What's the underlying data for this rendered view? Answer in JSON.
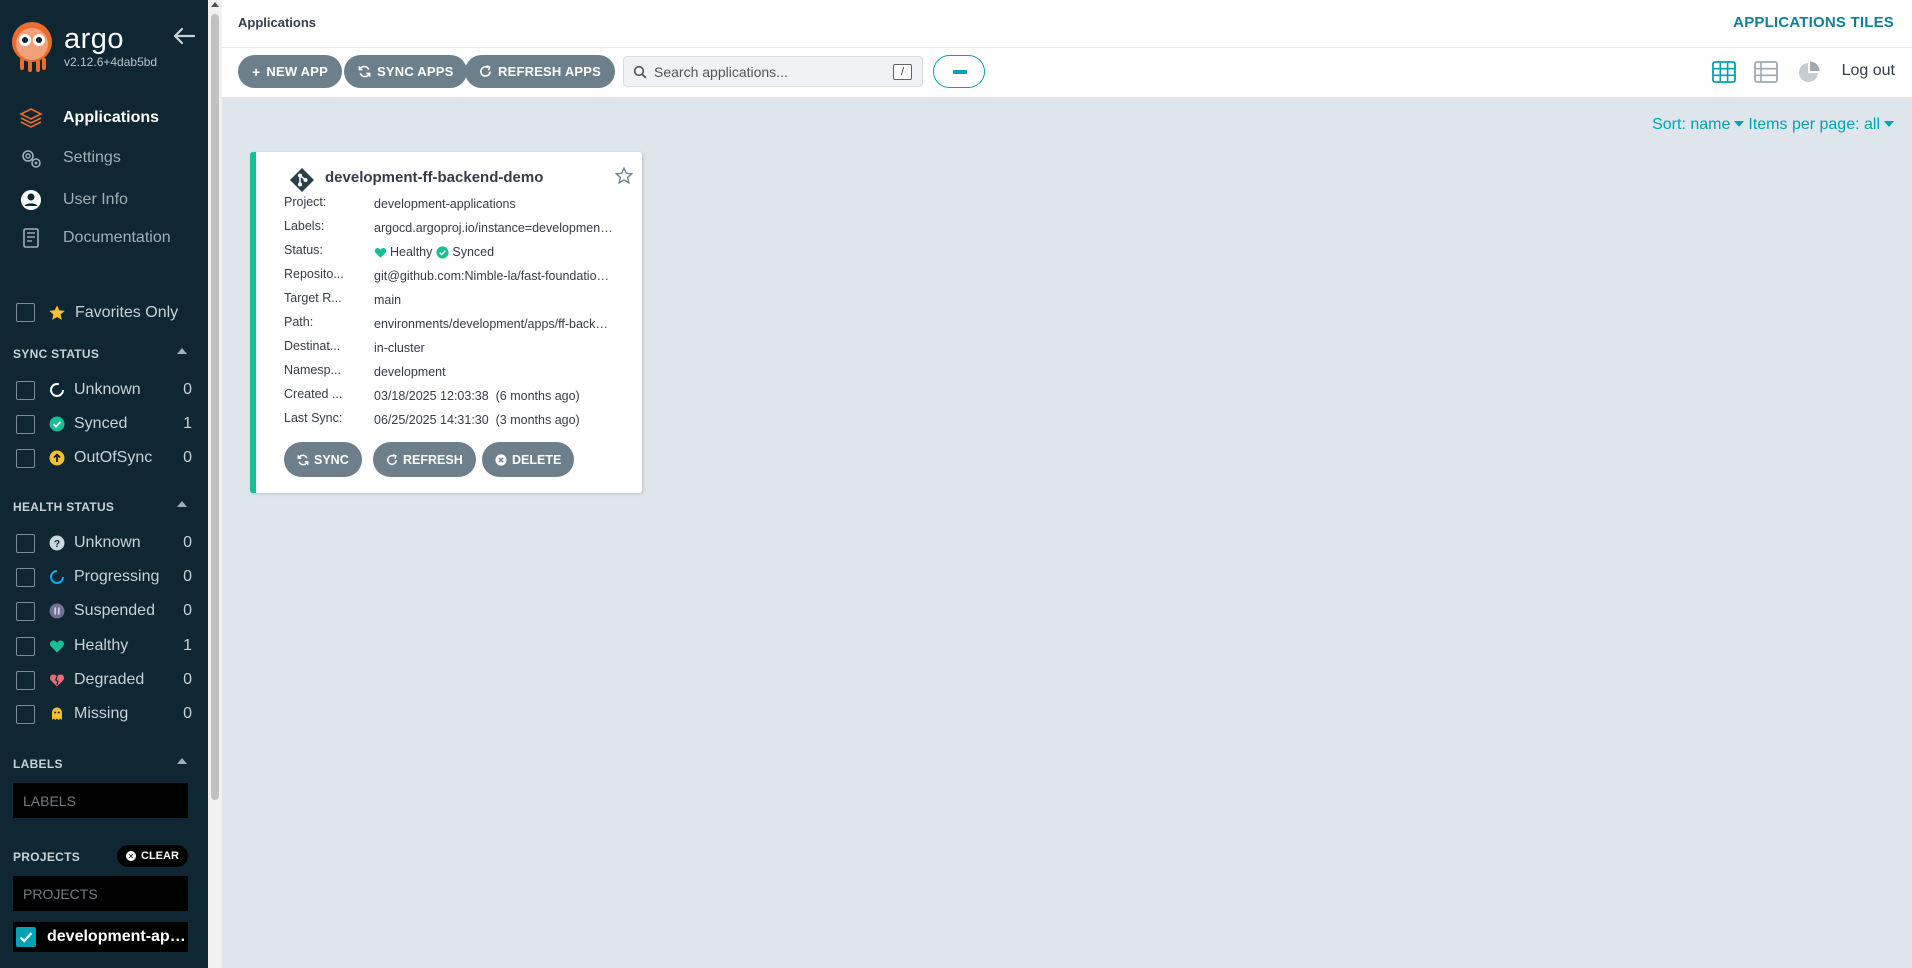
{
  "sidebar": {
    "logo_name": "argo",
    "version": "v2.12.6+4dab5bd",
    "nav": [
      {
        "label": "Applications"
      },
      {
        "label": "Settings"
      },
      {
        "label": "User Info"
      },
      {
        "label": "Documentation"
      }
    ],
    "favorites_label": "Favorites Only",
    "sync_status": {
      "title": "SYNC STATUS",
      "items": [
        {
          "label": "Unknown",
          "count": "0"
        },
        {
          "label": "Synced",
          "count": "1"
        },
        {
          "label": "OutOfSync",
          "count": "0"
        }
      ]
    },
    "health_status": {
      "title": "HEALTH STATUS",
      "items": [
        {
          "label": "Unknown",
          "count": "0"
        },
        {
          "label": "Progressing",
          "count": "0"
        },
        {
          "label": "Suspended",
          "count": "0"
        },
        {
          "label": "Healthy",
          "count": "1"
        },
        {
          "label": "Degraded",
          "count": "0"
        },
        {
          "label": "Missing",
          "count": "0"
        }
      ]
    },
    "labels": {
      "title": "LABELS",
      "placeholder": "LABELS"
    },
    "projects": {
      "title": "PROJECTS",
      "clear_label": "CLEAR",
      "placeholder": "PROJECTS",
      "selected": "development-applications"
    }
  },
  "header": {
    "breadcrumb": "Applications",
    "title": "APPLICATIONS TILES"
  },
  "toolbar": {
    "new_app": "NEW APP",
    "sync_apps": "SYNC APPS",
    "refresh_apps": "REFRESH APPS",
    "search_placeholder": "Search applications...",
    "search_shortcut": "/",
    "logout": "Log out"
  },
  "sort": {
    "sort_label": "Sort: name",
    "per_page_label": "Items per page: all"
  },
  "app_card": {
    "name": "development-ff-backend-demo",
    "rows": [
      {
        "key": "Project:",
        "value": "development-applications"
      },
      {
        "key": "Labels:",
        "value": "argocd.argoproj.io/instance=development-applications"
      },
      {
        "key": "Status:",
        "health": "Healthy",
        "sync": "Synced"
      },
      {
        "key": "Reposito...",
        "value": "git@github.com:Nimble-la/fast-foundation.git"
      },
      {
        "key": "Target R...",
        "value": "main"
      },
      {
        "key": "Path:",
        "value": "environments/development/apps/ff-backend-demo"
      },
      {
        "key": "Destinat...",
        "value": "in-cluster"
      },
      {
        "key": "Namesp...",
        "value": "development"
      },
      {
        "key": "Created ...",
        "value": "03/18/2025 12:03:38  (6 months ago)"
      },
      {
        "key": "Last Sync:",
        "value": "06/25/2025 14:31:30  (3 months ago)"
      }
    ],
    "buttons": {
      "sync": "SYNC",
      "refresh": "REFRESH",
      "delete": "DELETE"
    }
  },
  "colors": {
    "sidebar_bg": "#0f2733",
    "accent": "#00a2b3",
    "healthy": "#18be94",
    "out_of_sync": "#f4c030",
    "degraded": "#e96d76",
    "button_gray": "#6d7f8b"
  },
  "icons": {
    "nav": [
      "layers-icon",
      "gear-icon",
      "user-icon",
      "book-icon"
    ],
    "sync": [
      "circle-notch-icon",
      "check-circle-icon",
      "arrow-up-circle-icon"
    ],
    "health": [
      "question-circle-icon",
      "spinner-icon",
      "pause-circle-icon",
      "heart-icon",
      "broken-heart-icon",
      "ghost-icon"
    ]
  }
}
